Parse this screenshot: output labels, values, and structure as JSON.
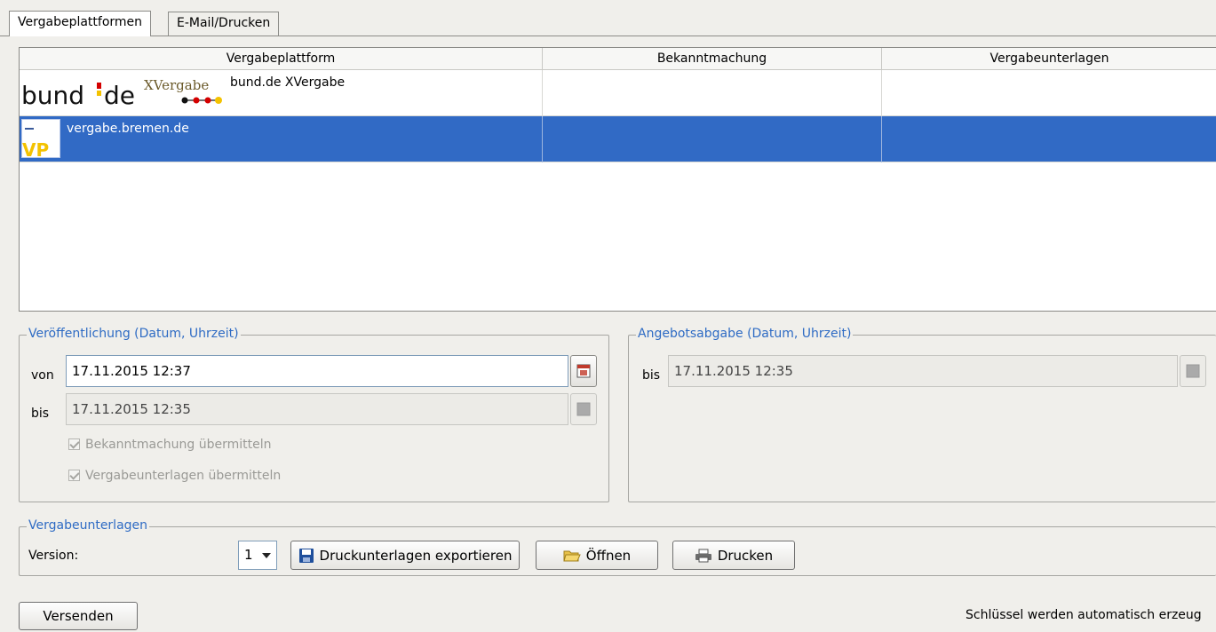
{
  "tabs": [
    {
      "label": "Vergabeplattformen",
      "active": true
    },
    {
      "label": "E-Mail/Drucken",
      "active": false
    }
  ],
  "table": {
    "columns": [
      "Vergabeplattform",
      "Bekanntmachung",
      "Vergabeunterlagen"
    ],
    "rows": [
      {
        "name": "bund.de XVergabe",
        "logo": "bund-de-xvergabe-logo",
        "logo_text_bund": "bund",
        "logo_text_de": "de",
        "logo_text_xvergabe": "XVergabe",
        "selected": false
      },
      {
        "name": "vergabe.bremen.de",
        "logo": "vp-logo",
        "selected": true
      }
    ]
  },
  "publication": {
    "legend": "Veröffentlichung (Datum, Uhrzeit)",
    "from_label": "von",
    "from_value": "17.11.2015 12:37",
    "to_label": "bis",
    "to_value": "17.11.2015 12:35",
    "checkbox_announcement": "Bekanntmachung übermitteln",
    "checkbox_documents": "Vergabeunterlagen übermitteln"
  },
  "offer": {
    "legend": "Angebotsabgabe (Datum, Uhrzeit)",
    "to_label": "bis",
    "to_value": "17.11.2015 12:35"
  },
  "documents": {
    "legend": "Vergabeunterlagen",
    "version_label": "Version:",
    "version_value": "1",
    "export_button": "Druckunterlagen exportieren",
    "open_button": "Öffnen",
    "print_button": "Drucken"
  },
  "footer": {
    "send_button": "Versenden",
    "status": "Schlüssel werden automatisch erzeug"
  },
  "colors": {
    "selection": "#316ac5",
    "legend_text": "#2e6bc4",
    "background": "#f0efeb"
  },
  "icons": [
    "calendar-icon",
    "save-icon",
    "folder-open-icon",
    "printer-icon",
    "dropdown-arrow-icon",
    "checkbox-icon"
  ]
}
